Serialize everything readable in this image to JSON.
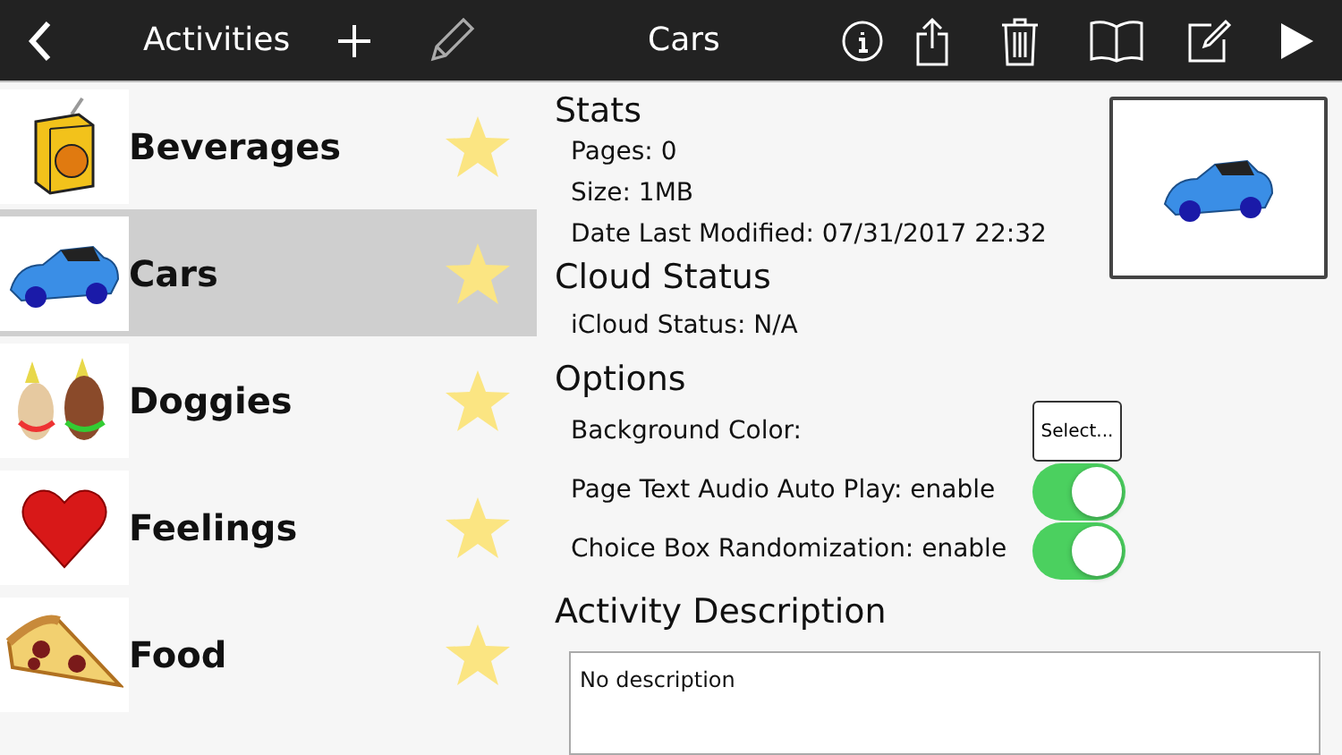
{
  "header": {
    "list_title": "Activities",
    "title": "Cars"
  },
  "activities": [
    {
      "name": "Beverages",
      "kind": "juice",
      "selected": false,
      "starred": true
    },
    {
      "name": "Cars",
      "kind": "car",
      "selected": true,
      "starred": true
    },
    {
      "name": "Doggies",
      "kind": "dogs",
      "selected": false,
      "starred": true
    },
    {
      "name": "Feelings",
      "kind": "heart",
      "selected": false,
      "starred": true
    },
    {
      "name": "Food",
      "kind": "pizza",
      "selected": false,
      "starred": true
    }
  ],
  "stats": {
    "heading": "Stats",
    "lines": [
      "Pages: 0",
      "Size: 1MB",
      "Date Last Modified: 07/31/2017 22:32"
    ]
  },
  "cloud": {
    "heading": "Cloud Status",
    "lines": [
      "iCloud Status: N/A"
    ]
  },
  "options": {
    "heading": "Options",
    "items": [
      {
        "kind": "button",
        "label": "Background Color:",
        "button": "Select..."
      },
      {
        "kind": "toggle",
        "label": "Page Text Audio Auto Play: enable",
        "on": true
      },
      {
        "kind": "toggle",
        "label": "Choice Box Randomization: enable",
        "on": true
      }
    ]
  },
  "description": {
    "heading": "Activity Description",
    "value": "No description"
  }
}
